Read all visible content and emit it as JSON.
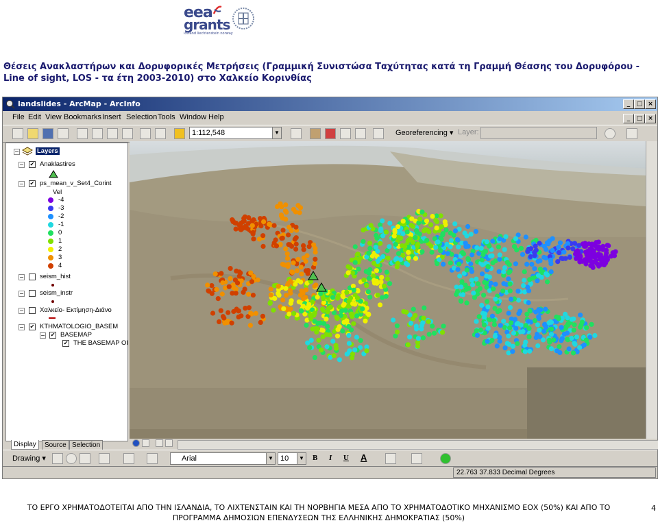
{
  "header": {
    "logo_eea": "eea",
    "logo_grants": "grants",
    "logo_sub": "iceland liechtenstein norway",
    "seal_icon": "greek-seal-icon"
  },
  "doc_title": "Θέσεις Ανακλαστήρων και Δορυφορικές Μετρήσεις (Γραμμική Συνιστώσα Ταχύτητας κατά τη Γραμμή Θέασης του Δορυφόρου - Line of sight, LOS - τα έτη 2003-2010) στο Χαλκείο Κορινθίας",
  "window": {
    "title": "landslides - ArcMap - ArcInfo",
    "menus": [
      "File",
      "Edit",
      "View",
      "Bookmarks",
      "Insert",
      "Selection",
      "Tools",
      "Window",
      "Help"
    ],
    "scale": "1:112,548",
    "georeferencing": "Georeferencing ▾",
    "layer_label": "Layer:",
    "font_name": "Arial",
    "font_size": "10",
    "drawing": "Drawing ▾",
    "coords": "22.763  37.833 Decimal Degrees",
    "bold_label": "B",
    "italic_label": "I",
    "underline_label": "U",
    "text_color_label": "A"
  },
  "toc": {
    "root": "Layers",
    "layers": [
      {
        "name": "Anaklastires",
        "checked": true
      },
      {
        "name": "ps_mean_v_Set4_Corint",
        "checked": true
      },
      {
        "name": "seism_hist",
        "checked": false
      },
      {
        "name": "seism_instr",
        "checked": false
      },
      {
        "name": "Χαλκείο- Εκτίμηση-Διάνο",
        "checked": false
      },
      {
        "name": "KTHMATOLOGIO_BASEM",
        "checked": true
      },
      {
        "name": "BASEMAP",
        "checked": true
      },
      {
        "name": "THE BASEMAP OI",
        "checked": true
      }
    ],
    "legend_title": "Vel",
    "legend": [
      {
        "label": "-4",
        "color": "#7c00e0"
      },
      {
        "label": "-3",
        "color": "#3a3af0"
      },
      {
        "label": "-2",
        "color": "#1e90ff"
      },
      {
        "label": "-1",
        "color": "#20d8e0"
      },
      {
        "label": "0",
        "color": "#20e060"
      },
      {
        "label": "1",
        "color": "#80e000"
      },
      {
        "label": "2",
        "color": "#f0f000"
      },
      {
        "label": "3",
        "color": "#f09000"
      },
      {
        "label": "4",
        "color": "#d04000"
      }
    ],
    "tabs": [
      "Display",
      "Source",
      "Selection"
    ]
  },
  "footer": {
    "line1": "ΤΟ ΕΡΓΟ ΧΡΗΜΑΤΟΔΟΤΕΙΤΑΙ ΑΠΟ ΤΗΝ ΙΣΛΑΝΔΙΑ, ΤΟ ΛΙΧΤΕΝΣΤΑΙΝ ΚΑΙ ΤΗ ΝΟΡΒΗΓΙΑ ΜΕΣΑ ΑΠΟ ΤΟ ΧΡΗΜΑΤΟΔΟΤΙΚΟ ΜΗΧΑΝΙΣΜΟ ΕΟΧ (50%) ΚΑΙ ΑΠΟ ΤΟ",
    "line2": "ΠΡΟΓΡΑΜΜΑ ΔΗΜΟΣΙΩΝ ΕΠΕΝΔΥΣΕΩΝ ΤΗΣ ΕΛΛΗΝΙΚΗΣ ΔΗΜΟΚΡΑΤΙΑΣ (50%)",
    "page": "4"
  }
}
